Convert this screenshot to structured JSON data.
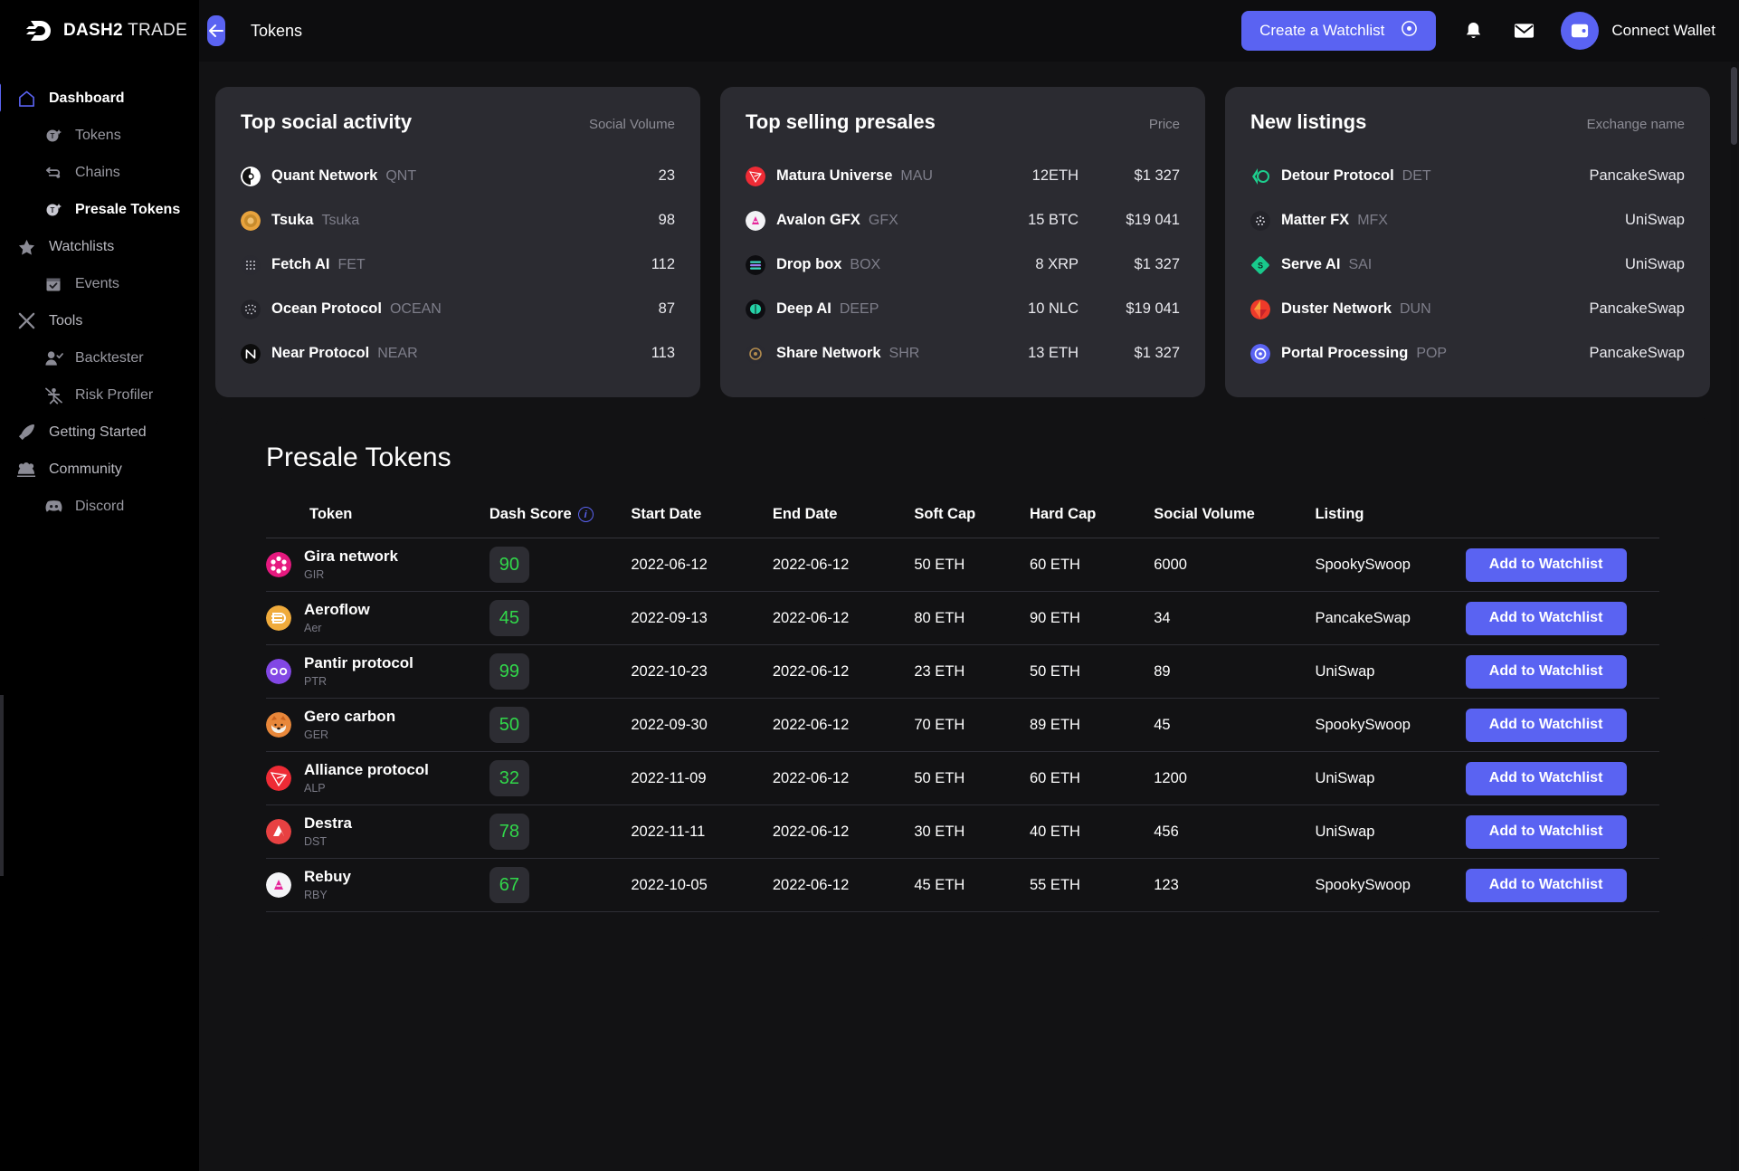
{
  "topbar": {
    "brand_bold": "DASH2",
    "brand_rest": " TRADE",
    "back_icon": "arrow-left-icon",
    "breadcrumb": "Tokens",
    "create_watchlist_label": "Create a Watchlist",
    "notifications_icon": "bell-icon",
    "messages_icon": "envelope-icon",
    "wallet_icon": "wallet-icon",
    "connect_wallet_label": "Connect Wallet",
    "accent_color": "#5a63f2"
  },
  "sidebar": {
    "items": [
      {
        "label": "Dashboard",
        "icon": "home-icon",
        "level": "top",
        "active": true
      },
      {
        "label": "Tokens",
        "icon": "token-icon",
        "level": "sub",
        "active": false
      },
      {
        "label": "Chains",
        "icon": "chains-icon",
        "level": "sub",
        "active": false
      },
      {
        "label": "Presale Tokens",
        "icon": "token-icon",
        "level": "sub",
        "active": true
      },
      {
        "label": "Watchlists",
        "icon": "star-icon",
        "level": "top",
        "active": false
      },
      {
        "label": "Events",
        "icon": "calendar-icon",
        "level": "sub",
        "active": false
      },
      {
        "label": "Tools",
        "icon": "tools-icon",
        "level": "top",
        "active": false
      },
      {
        "label": "Backtester",
        "icon": "user-check-icon",
        "level": "sub",
        "active": false
      },
      {
        "label": "Risk Profiler",
        "icon": "risk-icon",
        "level": "sub",
        "active": false
      },
      {
        "label": "Getting Started",
        "icon": "rocket-icon",
        "level": "top",
        "active": false
      },
      {
        "label": "Community",
        "icon": "community-icon",
        "level": "top",
        "active": false
      },
      {
        "label": "Discord",
        "icon": "discord-icon",
        "level": "sub",
        "active": false
      }
    ]
  },
  "cards": {
    "social": {
      "title": "Top social activity",
      "metric_label": "Social Volume",
      "rows": [
        {
          "name": "Quant Network",
          "symbol": "QNT",
          "value": "23",
          "icon_color": "#ffffff",
          "icon_accent": "#111111"
        },
        {
          "name": "Tsuka",
          "symbol": "Tsuka",
          "value": "98",
          "icon_color": "#e8a33d",
          "icon_accent": "#c27f22"
        },
        {
          "name": "Fetch AI",
          "symbol": "FET",
          "value": "112",
          "icon_color": "#2a2a31",
          "icon_accent": "#c9c9d2"
        },
        {
          "name": "Ocean Protocol",
          "symbol": "OCEAN",
          "value": "87",
          "icon_color": "#222228",
          "icon_accent": "#dcdce4"
        },
        {
          "name": "Near Protocol",
          "symbol": "NEAR",
          "value": "113",
          "icon_color": "#0c0c0c",
          "icon_accent": "#ffffff"
        }
      ]
    },
    "presales": {
      "title": "Top selling presales",
      "metric_label": "Price",
      "rows": [
        {
          "name": "Matura Universe",
          "symbol": "MAU",
          "amount": "12ETH",
          "price": "$1 327",
          "icon_color": "#ee2b35",
          "icon_accent": "#ffffff"
        },
        {
          "name": "Avalon GFX",
          "symbol": "GFX",
          "amount": "15 BTC",
          "price": "$19 041",
          "icon_color": "#f2f2f5",
          "icon_accent": "#e6269a"
        },
        {
          "name": "Drop box",
          "symbol": "BOX",
          "amount": "8 XRP",
          "price": "$1 327",
          "icon_color": "#0d0d10",
          "icon_accent": "#3fd6c0"
        },
        {
          "name": "Deep AI",
          "symbol": "DEEP",
          "amount": "10 NLC",
          "price": "$19 041",
          "icon_color": "#0e0e12",
          "icon_accent": "#25d3a8"
        },
        {
          "name": "Share Network",
          "symbol": "SHR",
          "amount": "13 ETH",
          "price": "$1 327",
          "icon_color": "#2a2a31",
          "icon_accent": "#b08a4d"
        }
      ]
    },
    "listings": {
      "title": "New listings",
      "metric_label": "Exchange name",
      "rows": [
        {
          "name": "Detour Protocol",
          "symbol": "DET",
          "exchange": "PancakeSwap",
          "icon_color": "#1dcf8e",
          "icon_accent": "#0f0f12"
        },
        {
          "name": "Matter FX",
          "symbol": "MFX",
          "exchange": "UniSwap",
          "icon_color": "#232329",
          "icon_accent": "#d6d6de"
        },
        {
          "name": "Serve AI",
          "symbol": "SAI",
          "exchange": "UniSwap",
          "icon_color": "#19c98c",
          "icon_accent": "#0d2e24"
        },
        {
          "name": "Duster Network",
          "symbol": "DUN",
          "exchange": "PancakeSwap",
          "icon_color": "#ee3a2a",
          "icon_accent": "#f2a23a"
        },
        {
          "name": "Portal Processing",
          "symbol": "POP",
          "exchange": "PancakeSwap",
          "icon_color": "#5a63f2",
          "icon_accent": "#ffffff"
        }
      ]
    }
  },
  "presale_panel": {
    "title": "Presale Tokens",
    "info_icon": "info-icon",
    "columns": {
      "token": "Token",
      "score": "Dash Score",
      "start": "Start Date",
      "end": "End Date",
      "soft": "Soft Cap",
      "hard": "Hard Cap",
      "social": "Social Volume",
      "listing": "Listing",
      "action": ""
    },
    "add_button_label": "Add to Watchlist",
    "score_color": "#31d84a",
    "rows": [
      {
        "name": "Gira network",
        "symbol": "GIR",
        "score": "90",
        "start": "2022-06-12",
        "end": "2022-06-12",
        "soft": "50 ETH",
        "hard": "60 ETH",
        "social": "6000",
        "listing": "SpookySwoop",
        "icon_color": "#e6197f",
        "icon_accent": "#ffffff"
      },
      {
        "name": "Aeroflow",
        "symbol": "Aer",
        "score": "45",
        "start": "2022-09-13",
        "end": "2022-06-12",
        "soft": "80 ETH",
        "hard": "90 ETH",
        "social": "34",
        "listing": "PancakeSwap",
        "icon_color": "#f0ab3c",
        "icon_accent": "#ffffff"
      },
      {
        "name": "Pantir protocol",
        "symbol": "PTR",
        "score": "99",
        "start": "2022-10-23",
        "end": "2022-06-12",
        "soft": "23 ETH",
        "hard": "50 ETH",
        "social": "89",
        "listing": "UniSwap",
        "icon_color": "#8247e5",
        "icon_accent": "#ffffff"
      },
      {
        "name": "Gero carbon",
        "symbol": "GER",
        "score": "50",
        "start": "2022-09-30",
        "end": "2022-06-12",
        "soft": "70 ETH",
        "hard": "89 ETH",
        "social": "45",
        "listing": "SpookySwoop",
        "icon_color": "#e8873a",
        "icon_accent": "#ffffff"
      },
      {
        "name": "Alliance protocol",
        "symbol": "ALP",
        "score": "32",
        "start": "2022-11-09",
        "end": "2022-06-12",
        "soft": "50 ETH",
        "hard": "60 ETH",
        "social": "1200",
        "listing": "UniSwap",
        "icon_color": "#ee2b35",
        "icon_accent": "#ffffff"
      },
      {
        "name": "Destra",
        "symbol": "DST",
        "score": "78",
        "start": "2022-11-11",
        "end": "2022-06-12",
        "soft": "30 ETH",
        "hard": "40 ETH",
        "social": "456",
        "listing": "UniSwap",
        "icon_color": "#e84142",
        "icon_accent": "#ffffff"
      },
      {
        "name": "Rebuy",
        "symbol": "RBY",
        "score": "67",
        "start": "2022-10-05",
        "end": "2022-06-12",
        "soft": "45 ETH",
        "hard": "55 ETH",
        "social": "123",
        "listing": "SpookySwoop",
        "icon_color": "#f4f4f7",
        "icon_accent": "#e6269a"
      }
    ]
  }
}
